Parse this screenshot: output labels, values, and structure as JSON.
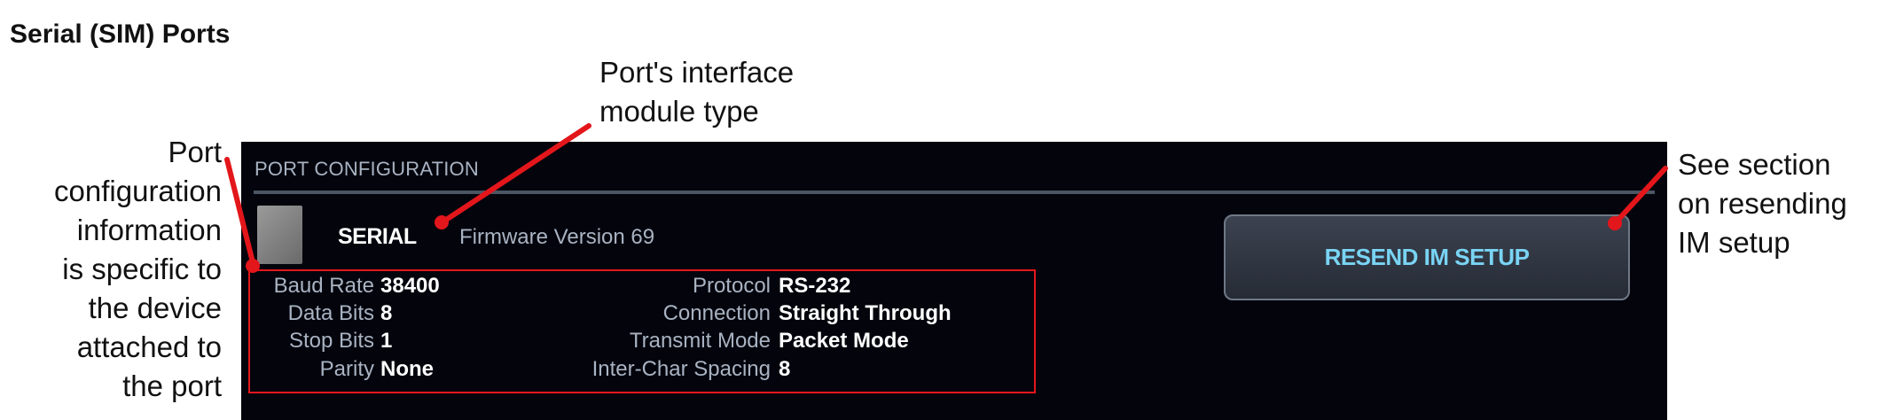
{
  "page_title": "Serial (SIM) Ports",
  "callouts": {
    "left": [
      "Port",
      "configuration",
      "information",
      "is specific to",
      "the device",
      "attached to",
      "the port"
    ],
    "top": [
      "Port's interface",
      "module type"
    ],
    "right": [
      "See section",
      "on resending",
      "IM setup"
    ]
  },
  "panel": {
    "header": "PORT CONFIGURATION",
    "module_icon": "serial-module-icon",
    "module_type": "SERIAL",
    "firmware": "Firmware Version 69",
    "resend_button": "RESEND IM SETUP",
    "config_left": [
      {
        "label": "Baud Rate",
        "value": "38400"
      },
      {
        "label": "Data Bits",
        "value": "8"
      },
      {
        "label": "Stop Bits",
        "value": "1"
      },
      {
        "label": "Parity",
        "value": "None"
      }
    ],
    "config_right": [
      {
        "label": "Protocol",
        "value": "RS-232"
      },
      {
        "label": "Connection",
        "value": "Straight Through"
      },
      {
        "label": "Transmit Mode",
        "value": "Packet Mode"
      },
      {
        "label": "Inter-Char Spacing",
        "value": "8"
      }
    ]
  },
  "colors": {
    "annotation_red": "#e3161b",
    "panel_bg": "#03040c",
    "label_gray": "#a9b3c2",
    "button_text": "#79d4f4"
  }
}
